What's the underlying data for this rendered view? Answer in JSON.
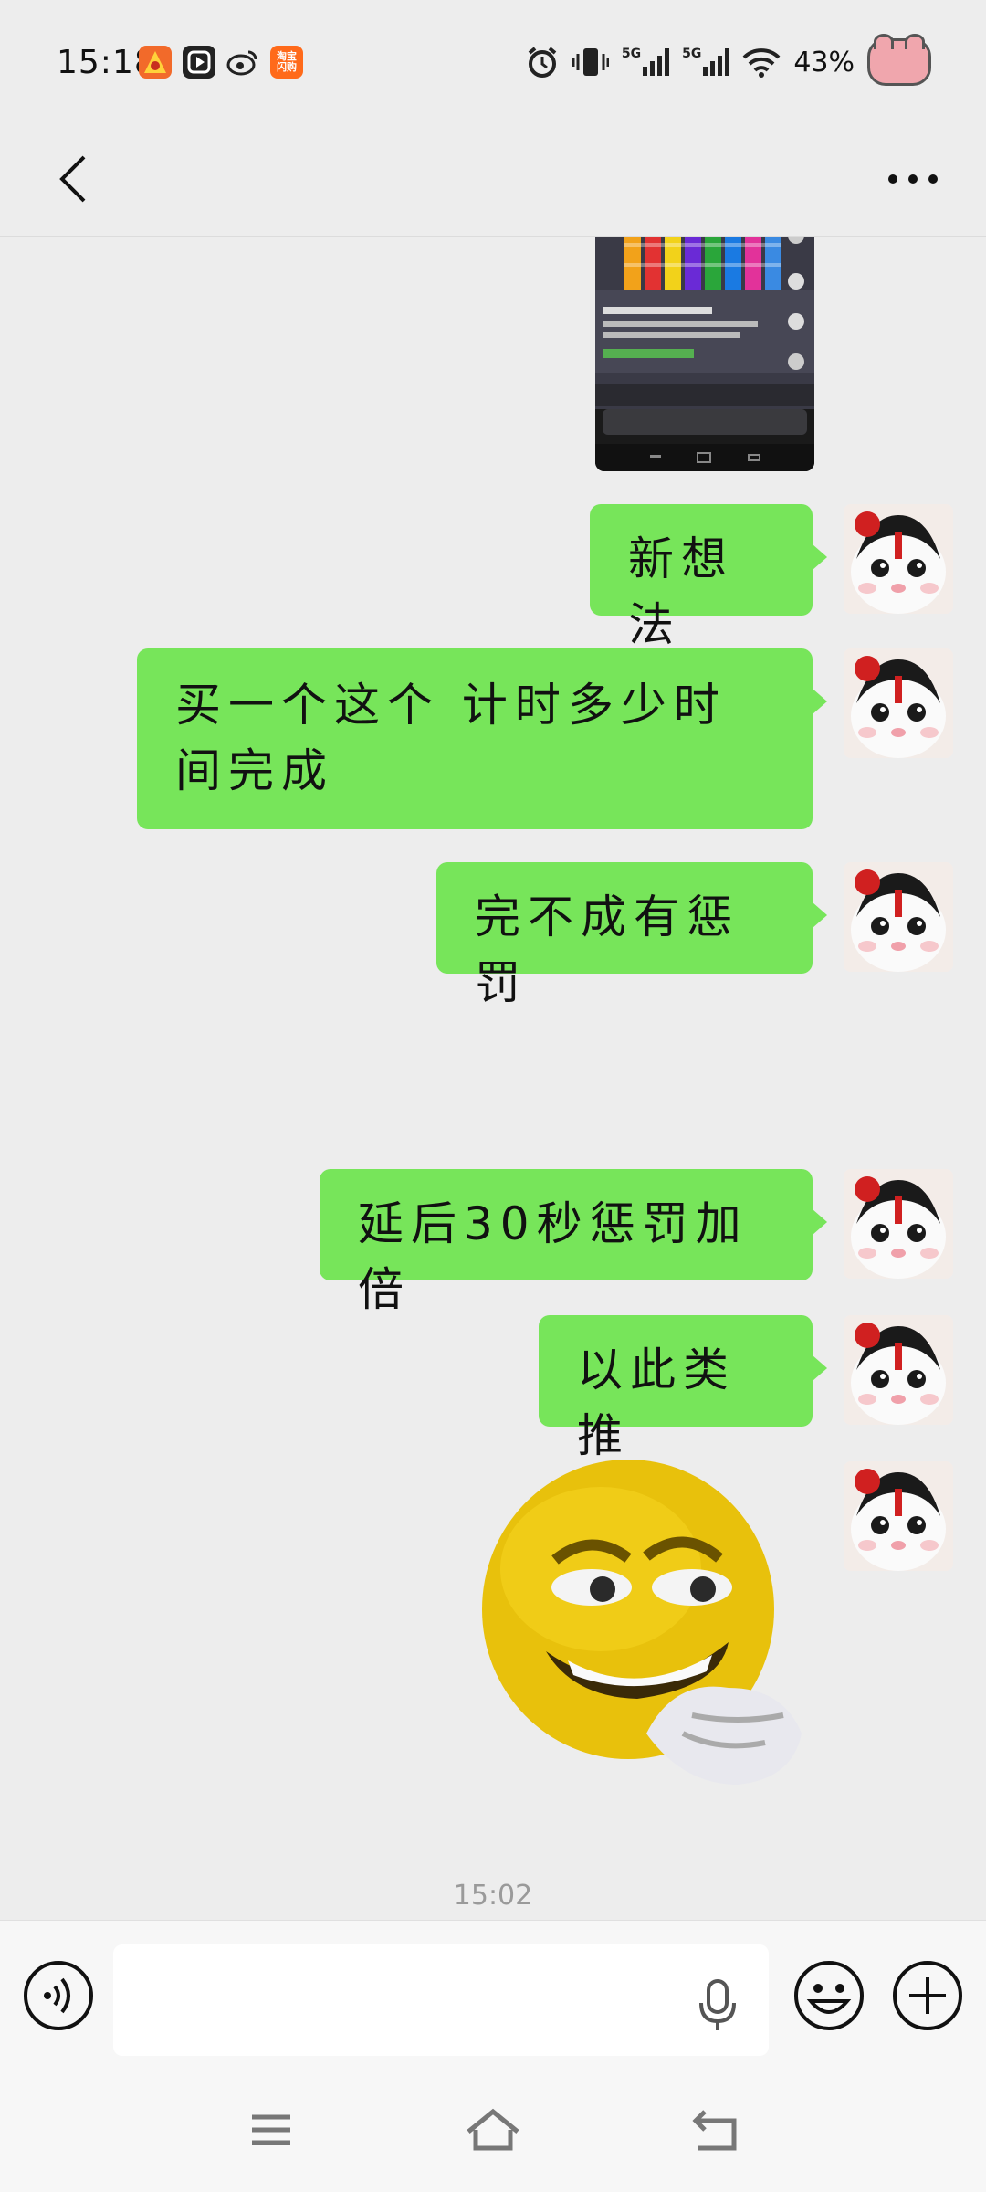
{
  "status_bar": {
    "time": "15:18",
    "notification_apps": [
      {
        "name": "game-app-icon",
        "label": "",
        "color": "#f26a2a"
      },
      {
        "name": "video-app-icon",
        "label": "",
        "color": "#222222"
      },
      {
        "name": "weibo-icon",
        "label": "",
        "color": "#ededed"
      },
      {
        "name": "taobao-icon",
        "label": "淘宝\n闪购",
        "color": "#ff6a1a"
      }
    ],
    "network_1": "5G",
    "network_2": "5G",
    "battery": "43%"
  },
  "nav": {
    "back_icon": "chevron-left-icon",
    "more_icon": "more-dots-icon"
  },
  "messages": [
    {
      "type": "image",
      "sender": "me"
    },
    {
      "type": "text",
      "sender": "me",
      "text": "新想法"
    },
    {
      "type": "text",
      "sender": "me",
      "text": "买一个这个 计时多少时间完成"
    },
    {
      "type": "text",
      "sender": "me",
      "text": "完不成有惩罚"
    },
    {
      "type": "text",
      "sender": "me",
      "text": "延后30秒惩罚加倍"
    },
    {
      "type": "text",
      "sender": "me",
      "text": "以此类推"
    },
    {
      "type": "sticker",
      "sender": "me"
    }
  ],
  "timestamp": "15:02",
  "input": {
    "value": "",
    "placeholder": ""
  },
  "colors": {
    "bubble": "#77e55a",
    "background": "#ededed"
  }
}
